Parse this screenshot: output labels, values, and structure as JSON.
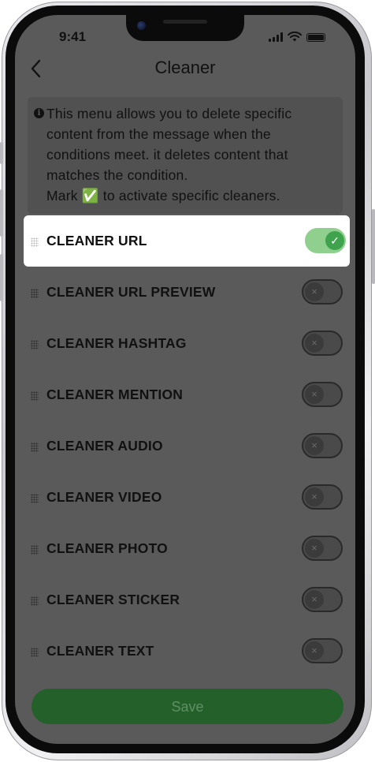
{
  "status_bar": {
    "time": "9:41"
  },
  "header": {
    "back_icon": "‹",
    "title": "Cleaner"
  },
  "info": {
    "icon": "i",
    "text": "This menu allows you to delete specific content from the message when the conditions meet. it deletes content that matches the condition.\nMark ✅ to activate specific cleaners."
  },
  "cleaners": [
    {
      "label": "CLEANER URL",
      "enabled": true,
      "knob": "✓"
    },
    {
      "label": "CLEANER URL PREVIEW",
      "enabled": false,
      "knob": "×"
    },
    {
      "label": "CLEANER HASHTAG",
      "enabled": false,
      "knob": "×"
    },
    {
      "label": "CLEANER MENTION",
      "enabled": false,
      "knob": "×"
    },
    {
      "label": "CLEANER AUDIO",
      "enabled": false,
      "knob": "×"
    },
    {
      "label": "CLEANER VIDEO",
      "enabled": false,
      "knob": "×"
    },
    {
      "label": "CLEANER PHOTO",
      "enabled": false,
      "knob": "×"
    },
    {
      "label": "CLEANER STICKER",
      "enabled": false,
      "knob": "×"
    },
    {
      "label": "CLEANER TEXT",
      "enabled": false,
      "knob": "×"
    }
  ],
  "footer": {
    "save_label": "Save"
  },
  "colors": {
    "overlay": "#5a5a5a",
    "accent_green": "#3fa34d",
    "toggle_on_track": "#8fd08f",
    "save_button": "#24612a"
  }
}
